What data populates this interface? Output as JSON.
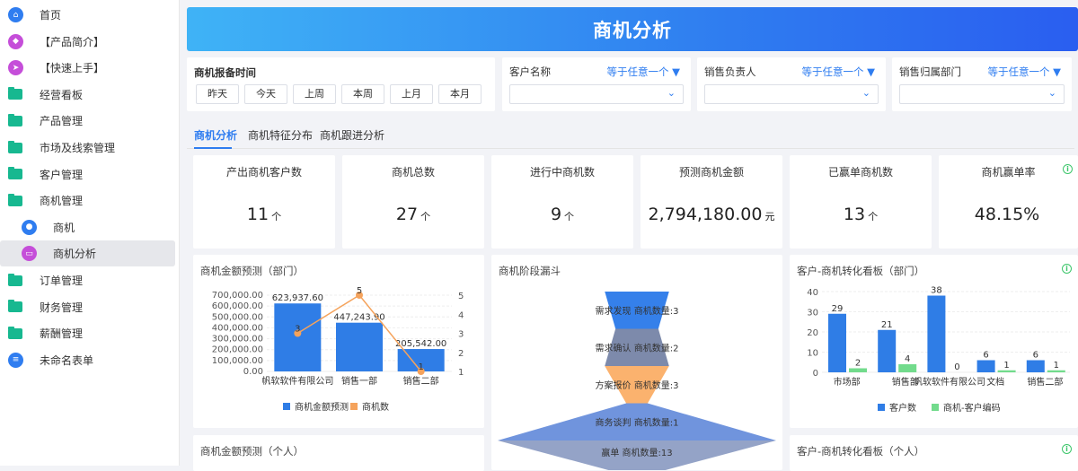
{
  "sidebar": {
    "items": [
      {
        "label": "首页",
        "icon": "home-icon",
        "color": "#2f7df0",
        "type": "circle",
        "glyph": "⌂"
      },
      {
        "label": "【产品简介】",
        "icon": "tag-icon",
        "color": "#c54ed9",
        "type": "circle",
        "glyph": "◆"
      },
      {
        "label": "【快速上手】",
        "icon": "send-icon",
        "color": "#c54ed9",
        "type": "circle",
        "glyph": "➤"
      },
      {
        "label": "经营看板",
        "icon": "folder-icon",
        "type": "folder"
      },
      {
        "label": "产品管理",
        "icon": "folder-icon",
        "type": "folder"
      },
      {
        "label": "市场及线索管理",
        "icon": "folder-icon",
        "type": "folder"
      },
      {
        "label": "客户管理",
        "icon": "folder-icon",
        "type": "folder"
      },
      {
        "label": "商机管理",
        "icon": "folder-open-icon",
        "type": "folder"
      },
      {
        "label": "商机",
        "icon": "target-icon",
        "color": "#2f7df0",
        "type": "circle",
        "glyph": "●",
        "sub": true
      },
      {
        "label": "商机分析",
        "icon": "presentation-icon",
        "color": "#c54ed9",
        "type": "circle",
        "glyph": "▭",
        "sub": true,
        "active": true
      },
      {
        "label": "订单管理",
        "icon": "folder-icon",
        "type": "folder"
      },
      {
        "label": "财务管理",
        "icon": "folder-icon",
        "type": "folder"
      },
      {
        "label": "薪酬管理",
        "icon": "folder-icon",
        "type": "folder"
      },
      {
        "label": "未命名表单",
        "icon": "form-icon",
        "color": "#2f7df0",
        "type": "circle",
        "glyph": "≡"
      }
    ]
  },
  "banner": {
    "title": "商机分析"
  },
  "filters": {
    "date_label": "商机报备时间",
    "quick": [
      "昨天",
      "今天",
      "上周",
      "本周",
      "上月",
      "本月"
    ],
    "fields": [
      {
        "label": "客户名称",
        "op": "等于任意一个 ▼"
      },
      {
        "label": "销售负责人",
        "op": "等于任意一个 ▼"
      },
      {
        "label": "销售归属部门",
        "op": "等于任意一个 ▼"
      }
    ]
  },
  "tabs": [
    "商机分析",
    "商机特征分布",
    "商机跟进分析"
  ],
  "kpis": [
    {
      "title": "产出商机客户数",
      "value": "11",
      "unit": "个"
    },
    {
      "title": "商机总数",
      "value": "27",
      "unit": "个"
    },
    {
      "title": "进行中商机数",
      "value": "9",
      "unit": "个"
    },
    {
      "title": "预测商机金额",
      "value": "2,794,180.00",
      "unit": "元"
    },
    {
      "title": "已赢单商机数",
      "value": "13",
      "unit": "个"
    },
    {
      "title": "商机赢单率",
      "value": "48.15%",
      "unit": ""
    }
  ],
  "bottom": {
    "left_title": "商机金额预测（个人）",
    "right_title": "客户-商机转化看板（个人）"
  },
  "chart_data": [
    {
      "type": "bar",
      "title": "商机金额预测（部门）",
      "categories": [
        "帆软软件有限公司",
        "销售一部",
        "销售二部"
      ],
      "series": [
        {
          "name": "商机金额预测",
          "kind": "bar",
          "values": [
            623937.6,
            447243.9,
            205542.0
          ],
          "labels": [
            "623,937.60",
            "447,243.90",
            "205,542.00"
          ],
          "color": "#2f7de6"
        },
        {
          "name": "商机数",
          "kind": "line",
          "values": [
            3,
            5,
            1
          ],
          "color": "#f5a35c"
        }
      ],
      "y_ticks": [
        "700,000.00",
        "600,000.00",
        "500,000.00",
        "400,000.00",
        "300,000.00",
        "200,000.00",
        "100,000.00",
        "0.00"
      ],
      "ylim": [
        0,
        700000
      ],
      "y2_ticks": [
        "5",
        "4",
        "3",
        "2",
        "1"
      ],
      "y2lim": [
        1,
        5
      ]
    },
    {
      "type": "funnel",
      "title": "商机阶段漏斗",
      "series_name": "商机数量",
      "stages": [
        {
          "name": "需求发现",
          "value": 3,
          "color": "#3580ea"
        },
        {
          "name": "需求确认",
          "value": 2,
          "color": "#7d8aab"
        },
        {
          "name": "方案报价",
          "value": 3,
          "color": "#fbb26e"
        },
        {
          "name": "商务谈判",
          "value": 1,
          "color": "#7094dd"
        },
        {
          "name": "赢单",
          "value": 13,
          "color": "#94a3c7"
        }
      ]
    },
    {
      "type": "bar",
      "title": "客户-商机转化看板（部门）",
      "categories": [
        "市场部",
        "销售部",
        "帆软软件有限公司",
        "文档",
        "销售二部"
      ],
      "series": [
        {
          "name": "客户数",
          "values": [
            29,
            21,
            38,
            6,
            6
          ],
          "color": "#2f7de6"
        },
        {
          "name": "商机-客户编码",
          "values": [
            2,
            4,
            0,
            1,
            1
          ],
          "color": "#72db8c"
        }
      ],
      "y_ticks": [
        "40",
        "30",
        "20",
        "10",
        "0"
      ],
      "ylim": [
        0,
        40
      ]
    }
  ]
}
